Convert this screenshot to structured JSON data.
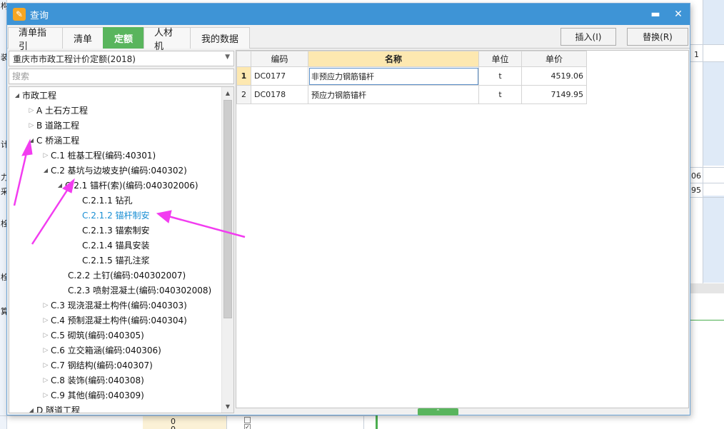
{
  "background": {
    "fragments_left": [
      "构",
      "装",
      "计",
      "力",
      "采",
      "栓",
      "栓",
      "算"
    ],
    "fragments_right": [
      "1",
      "06",
      "95"
    ],
    "bottom_values": [
      "0",
      "0"
    ]
  },
  "dialog": {
    "title": "查询",
    "app_icon": "app-logo-icon",
    "minimize_symbol": "▬",
    "close_symbol": "✕"
  },
  "tabs": [
    {
      "label": "清单指引",
      "active": false
    },
    {
      "label": "清单",
      "active": false
    },
    {
      "label": "定额",
      "active": true
    },
    {
      "label": "人材机",
      "active": false
    },
    {
      "label": "我的数据",
      "active": false
    }
  ],
  "actions": {
    "insert": "插入(I)",
    "replace": "替换(R)"
  },
  "library": {
    "selected": "重庆市市政工程计价定额(2018)"
  },
  "search": {
    "placeholder": "搜索"
  },
  "tree": [
    {
      "label": "市政工程",
      "state": "expanded"
    },
    {
      "label": "A 土石方工程",
      "state": "collapsed"
    },
    {
      "label": "B 道路工程",
      "state": "collapsed"
    },
    {
      "label": "C 桥涵工程",
      "state": "expanded"
    },
    {
      "label": "C.1 桩基工程(编码:40301)",
      "state": "collapsed"
    },
    {
      "label": "C.2 基坑与边坡支护(编码:040302)",
      "state": "expanded"
    },
    {
      "label": "C.2.1 锚杆(索)(编码:040302006)",
      "state": "expanded"
    },
    {
      "label": "C.2.1.1 钻孔",
      "state": "leaf"
    },
    {
      "label": "C.2.1.2 锚杆制安",
      "state": "leaf",
      "selected": true
    },
    {
      "label": "C.2.1.3 锚索制安",
      "state": "leaf"
    },
    {
      "label": "C.2.1.4 锚具安装",
      "state": "leaf"
    },
    {
      "label": "C.2.1.5 锚孔注浆",
      "state": "leaf"
    },
    {
      "label": "C.2.2 土钉(编码:040302007)",
      "state": "leaf"
    },
    {
      "label": "C.2.3 喷射混凝土(编码:040302008)",
      "state": "leaf"
    },
    {
      "label": "C.3 现浇混凝土构件(编码:040303)",
      "state": "collapsed"
    },
    {
      "label": "C.4 预制混凝土构件(编码:040304)",
      "state": "collapsed"
    },
    {
      "label": "C.5 砌筑(编码:040305)",
      "state": "collapsed"
    },
    {
      "label": "C.6 立交箱涵(编码:040306)",
      "state": "collapsed"
    },
    {
      "label": "C.7 钢结构(编码:040307)",
      "state": "collapsed"
    },
    {
      "label": "C.8 装饰(编码:040308)",
      "state": "collapsed"
    },
    {
      "label": "C.9 其他(编码:040309)",
      "state": "collapsed"
    },
    {
      "label": "D 隧道工程",
      "state": "expanded"
    }
  ],
  "grid": {
    "headers": {
      "code": "编码",
      "name": "名称",
      "unit": "单位",
      "price": "单价"
    },
    "rows": [
      {
        "index": "1",
        "code": "DC0177",
        "name": "非预应力钢筋锚杆",
        "unit": "t",
        "price": "4519.06"
      },
      {
        "index": "2",
        "code": "DC0178",
        "name": "预应力钢筋锚杆",
        "unit": "t",
        "price": "7149.95"
      }
    ]
  },
  "colors": {
    "titlebar": "#3e94d6",
    "active_tab": "#59b55d",
    "selected_tree_item": "#1a8fd4",
    "header_highlight": "#fde8b0",
    "annotation_arrow": "#f23cf0"
  }
}
